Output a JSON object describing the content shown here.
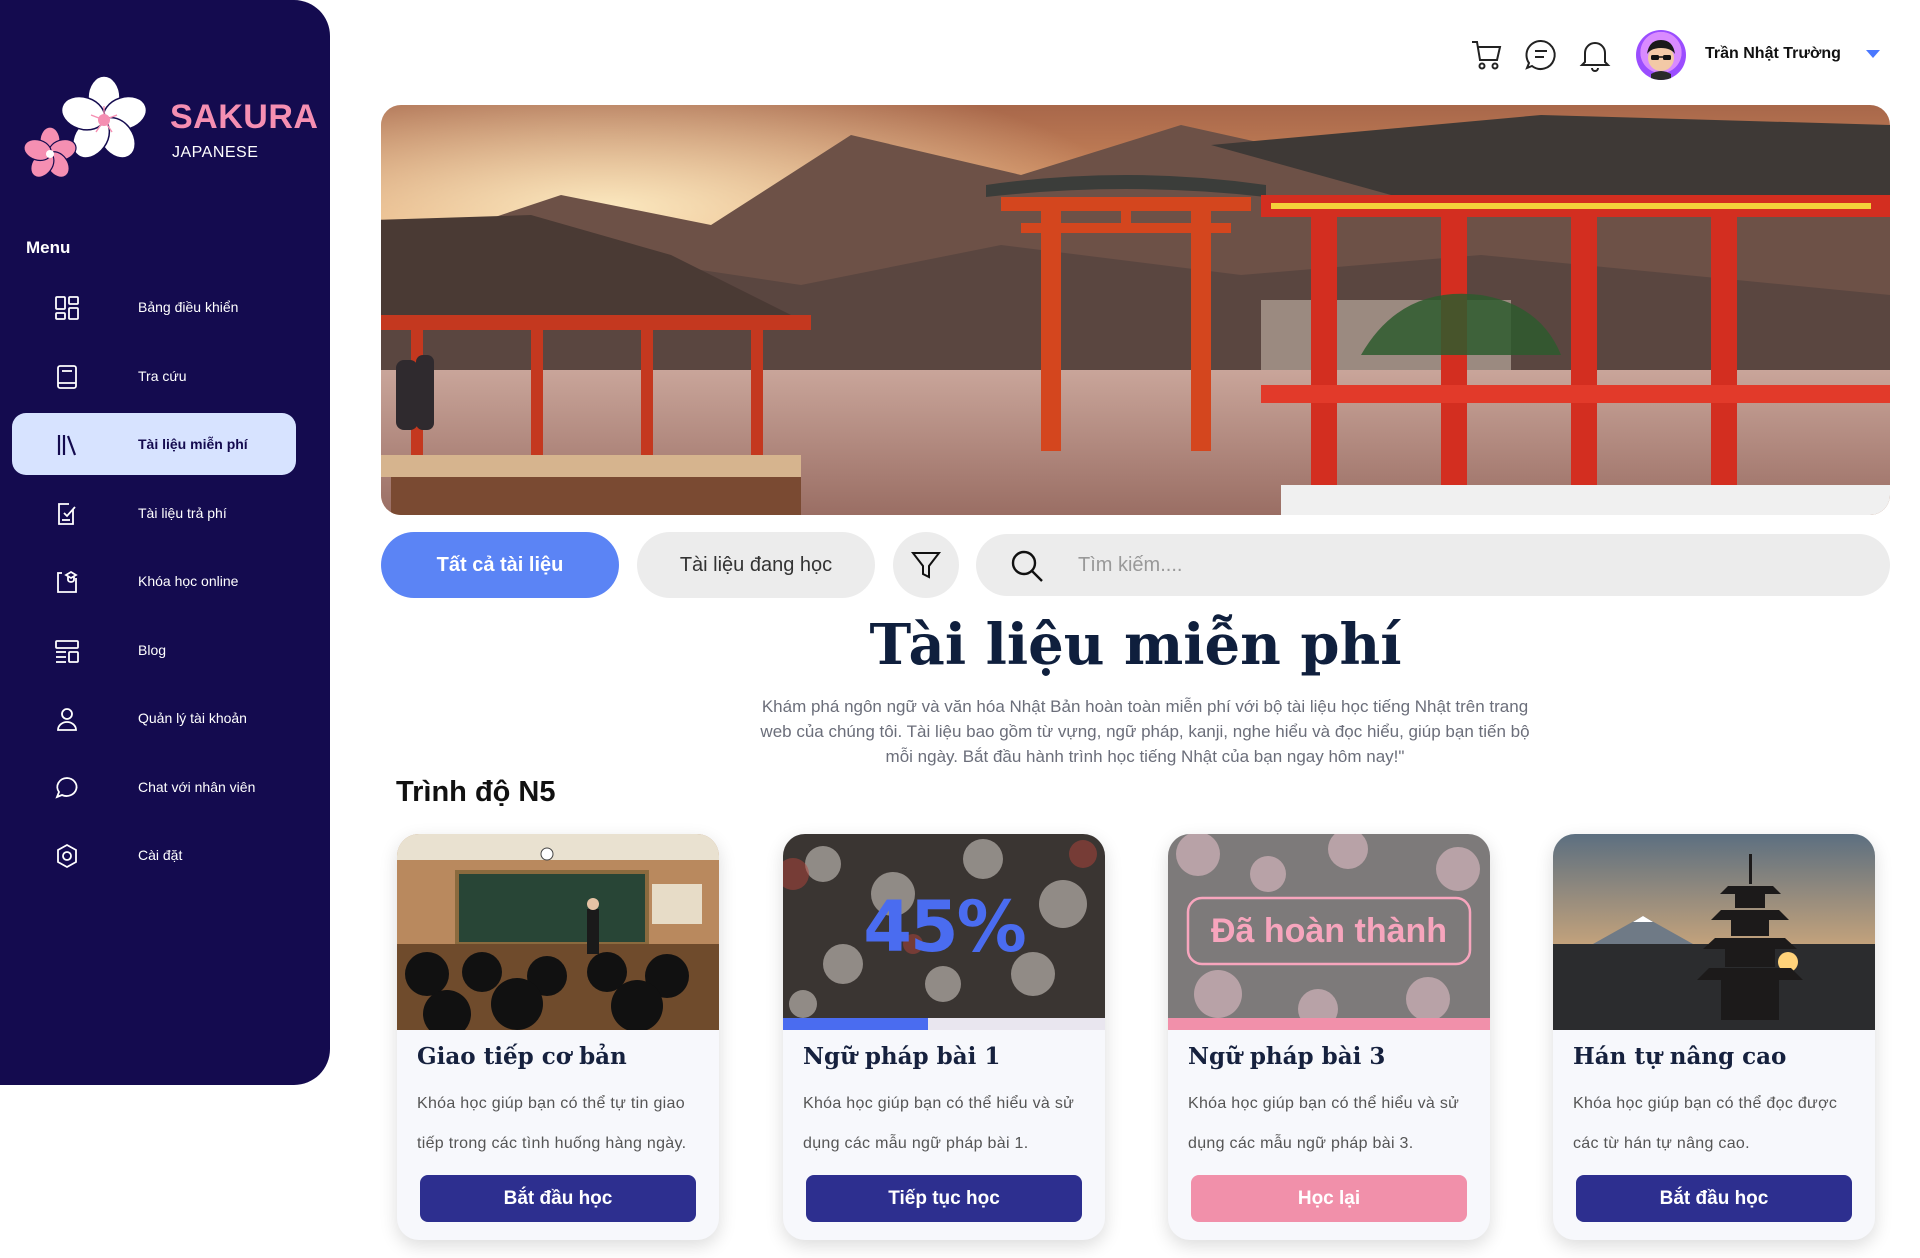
{
  "brand": {
    "name": "SAKURA",
    "subtitle": "JAPANESE"
  },
  "sidebar": {
    "menu_title": "Menu",
    "items": [
      {
        "label": "Bảng điều khiển",
        "icon": "dashboard-icon",
        "active": false
      },
      {
        "label": "Tra cứu",
        "icon": "book-icon",
        "active": false
      },
      {
        "label": "Tài liệu miễn phí",
        "icon": "library-icon",
        "active": true
      },
      {
        "label": "Tài liệu trả phí",
        "icon": "paid-document-icon",
        "active": false
      },
      {
        "label": "Khóa học online",
        "icon": "online-course-icon",
        "active": false
      },
      {
        "label": "Blog",
        "icon": "blog-icon",
        "active": false
      },
      {
        "label": "Quản lý tài khoản",
        "icon": "user-icon",
        "active": false
      },
      {
        "label": "Chat với nhân viên",
        "icon": "chat-icon",
        "active": false
      },
      {
        "label": "Cài đặt",
        "icon": "settings-icon",
        "active": false
      }
    ]
  },
  "header": {
    "icons": [
      "cart-icon",
      "message-icon",
      "bell-icon"
    ],
    "user_name": "Trần Nhật Trường"
  },
  "filters": {
    "all_label": "Tất cả tài liệu",
    "learning_label": "Tài liệu đang học",
    "search_placeholder": "Tìm kiếm...."
  },
  "main": {
    "title": "Tài liệu miễn phí",
    "description": "Khám phá ngôn ngữ và văn hóa Nhật Bản hoàn toàn miễn phí với bộ tài liệu học tiếng Nhật trên trang web của chúng tôi. Tài liệu bao gồm từ vựng, ngữ pháp, kanji, nghe hiểu và đọc hiểu, giúp bạn tiến bộ mỗi ngày. Bắt đầu hành trình học tiếng Nhật của bạn ngay hôm nay!\"",
    "level_title": "Trình độ N5"
  },
  "cards": [
    {
      "title": "Giao tiếp cơ bản",
      "description": "Khóa học giúp bạn có thể tự tin giao tiếp trong các tình huống hàng ngày.",
      "button": "Bắt đầu học",
      "overlay": "",
      "progress": null
    },
    {
      "title": "Ngữ pháp bài 1",
      "description": "Khóa học giúp bạn có thể hiểu và sử dụng các mẫu ngữ pháp bài 1.",
      "button": "Tiếp tục học",
      "overlay": "45%",
      "progress": 0.45
    },
    {
      "title": "Ngữ pháp bài 3",
      "description": "Khóa học giúp bạn có thể hiểu và sử dụng các mẫu ngữ pháp bài 3.",
      "button": "Học lại",
      "overlay": "Đã hoàn thành",
      "progress": 1.0
    },
    {
      "title": "Hán tự nâng cao",
      "description": "Khóa học giúp bạn có thể đọc được các từ hán tự nâng cao.",
      "button": "Bắt đầu học",
      "overlay": "",
      "progress": null
    }
  ],
  "colors": {
    "sidebar_bg": "#140b4f",
    "active_item_bg": "#d7e3ff",
    "accent_blue": "#5b84f5",
    "button_navy": "#2d2f8f",
    "sakura_pink": "#f58fb2"
  }
}
